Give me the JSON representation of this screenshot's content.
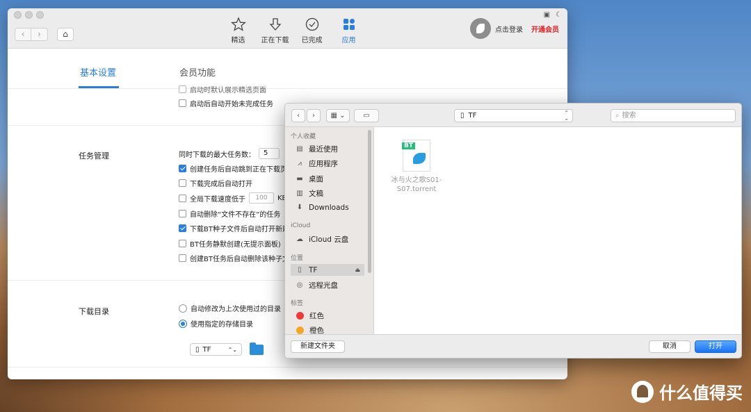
{
  "app": {
    "toolbar": [
      {
        "label": "精选",
        "icon": "star-icon"
      },
      {
        "label": "正在下载",
        "icon": "download-arrow-icon"
      },
      {
        "label": "已完成",
        "icon": "check-circle-icon"
      },
      {
        "label": "应用",
        "icon": "apps-grid-icon"
      }
    ],
    "user": {
      "login": "点击登录",
      "vip": "开通会员"
    },
    "tabs": [
      "基本设置",
      "会员功能"
    ],
    "settings": {
      "top_partial": "启动时默认展示精选页面",
      "auto_start": "启动后自动开始未完成任务",
      "task_section": "任务管理",
      "max_tasks_label": "同时下载的最大任务数：",
      "max_tasks_value": "5",
      "jump_downloading": "创建任务后自动跳到正在下载页",
      "auto_open": "下载完成后自动打开",
      "speed_limit_label": "全局下载速度低于",
      "speed_limit_value": "100",
      "speed_unit": "KB/",
      "auto_delete": "自动删除“文件不存在”的任务",
      "bt_open": "下载BT种子文件后自动打开新建",
      "bt_silent": "BT任务静默创建(无提示面板)",
      "bt_delete": "创建BT任务后自动删除该种子文",
      "dir_section": "下载目录",
      "last_used": "自动修改为上次使用过的目录",
      "specified": "使用指定的存储目录",
      "drive": "TF"
    }
  },
  "dialog": {
    "location": "TF",
    "search_placeholder": "搜索",
    "sidebar": {
      "favorites_head": "个人收藏",
      "favorites": [
        {
          "label": "最近使用",
          "icon": "recent-icon"
        },
        {
          "label": "应用程序",
          "icon": "applications-icon"
        },
        {
          "label": "桌面",
          "icon": "desktop-icon"
        },
        {
          "label": "文稿",
          "icon": "documents-icon"
        },
        {
          "label": "Downloads",
          "icon": "downloads-icon"
        }
      ],
      "icloud_head": "iCloud",
      "icloud": {
        "label": "iCloud 云盘",
        "icon": "cloud-icon"
      },
      "locations_head": "位置",
      "locations": [
        {
          "label": "TF",
          "icon": "drive-icon"
        },
        {
          "label": "远程光盘",
          "icon": "disc-icon"
        }
      ],
      "tags_head": "标签",
      "tags": [
        {
          "label": "红色",
          "color": "#f03a3a"
        },
        {
          "label": "橙色",
          "color": "#f5a623"
        }
      ]
    },
    "file": {
      "name_line1": "冰与火之歌S01-",
      "name_line2": "S07.torrent",
      "badge": "BT"
    },
    "new_folder": "新建文件夹",
    "cancel": "取消",
    "open": "打开"
  },
  "watermark": {
    "text": "什么值得买"
  }
}
